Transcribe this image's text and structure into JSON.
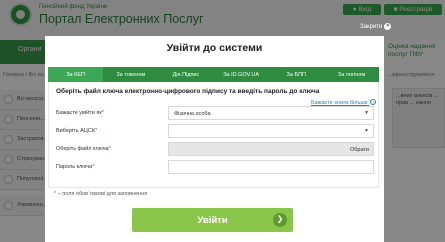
{
  "site": {
    "fund_name": "Пенсійний фонд України",
    "portal_title": "Портал Електронних Послуг",
    "login_label": "Вхід",
    "register_label": "Реєстрація"
  },
  "nav": {
    "organs_label": "Органи",
    "right_box": "Оцінка надання послуг ПФУ"
  },
  "breadcrumb": {
    "left": "Головна / Всі по...",
    "right": "...зареєструватися"
  },
  "sidebar": {
    "items": [
      {
        "label": "Всі веєкса..."
      },
      {
        "label": "Пенсіони..."
      },
      {
        "label": "Застрахов..."
      },
      {
        "label": "Страхуван..."
      },
      {
        "label": "Популярні..."
      },
      {
        "label": "Управлінн... виконанн..."
      }
    ]
  },
  "right_panel": {
    "text": "...вних анкесів ... прав ... нання"
  },
  "modal": {
    "close_label": "Закрити",
    "title": "Увійти до системи",
    "tabs": [
      {
        "label": "За КЕП",
        "active": true
      },
      {
        "label": "За токеном",
        "active": false
      },
      {
        "label": "Дія.Підпис",
        "active": false
      },
      {
        "label": "За ID.GOV.UA",
        "active": false
      },
      {
        "label": "За БПП",
        "active": false
      },
      {
        "label": "За логіном",
        "active": false
      }
    ],
    "instruction": "Оберіть файл ключа електронно-цифрового підпису та введіть пароль до ключа",
    "help_link": "Бажаєте знати більше",
    "fields": {
      "login_as_label": "Бажаєте увійти як",
      "login_as_value": "Фізична особа",
      "acsk_label": "Виберіть АЦСК",
      "acsk_value": "",
      "key_file_label": "Оберіть файл ключа",
      "browse_label": "Обрати",
      "password_label": "Пароль ключа"
    },
    "required_note": "– поля обов`язкові для заповнення",
    "submit_label": "Увійти"
  },
  "colors": {
    "brand_green": "#3b9a4d",
    "tab_bar": "#2e8b40",
    "tab_active": "#3ca855",
    "submit_button": "#8ac64a"
  }
}
